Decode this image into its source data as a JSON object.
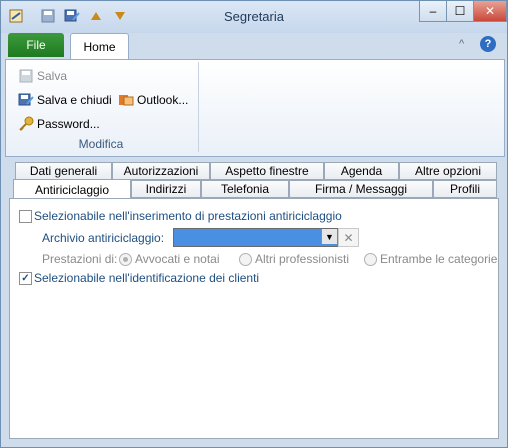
{
  "window": {
    "title": "Segretaria",
    "controls": {
      "minimize": "–",
      "maximize": "☐",
      "close": "✕"
    }
  },
  "quick_access": {
    "icons": [
      "app-icon",
      "save-icon",
      "save-close-icon",
      "up-arrow-icon",
      "down-arrow-icon"
    ]
  },
  "ribbon": {
    "tabs": {
      "file": "File",
      "home": "Home"
    },
    "help_icon": "?",
    "collapse_icon": "^",
    "group": {
      "name": "Modifica",
      "buttons": {
        "save": "Salva",
        "save_close": "Salva e chiudi",
        "outlook": "Outlook...",
        "password": "Password..."
      }
    }
  },
  "tabs_row1": [
    "Dati generali",
    "Autorizzazioni",
    "Aspetto finestre",
    "Agenda",
    "Altre opzioni"
  ],
  "tabs_row2": [
    "Antiriciclaggio",
    "Indirizzi",
    "Telefonia",
    "Firma / Messaggi",
    "Profili"
  ],
  "antiriciclaggio": {
    "selectable_inserimento": "Selezionabile nell'inserimento di prestazioni antiriciclaggio",
    "archivio_label": "Archivio antiriciclaggio:",
    "archivio_value": "",
    "prestazioni_label": "Prestazioni di:",
    "radio_options": [
      "Avvocati e notai",
      "Altri professionisti",
      "Entrambe le categorie"
    ],
    "selectable_identificazione": "Selezionabile nell'identificazione dei clienti",
    "check_inserimento": false,
    "check_identificazione": true
  },
  "colors": {
    "file_tab": "#1f7a1f",
    "accent": "#4a90e2",
    "text_blue": "#1e4f82"
  }
}
